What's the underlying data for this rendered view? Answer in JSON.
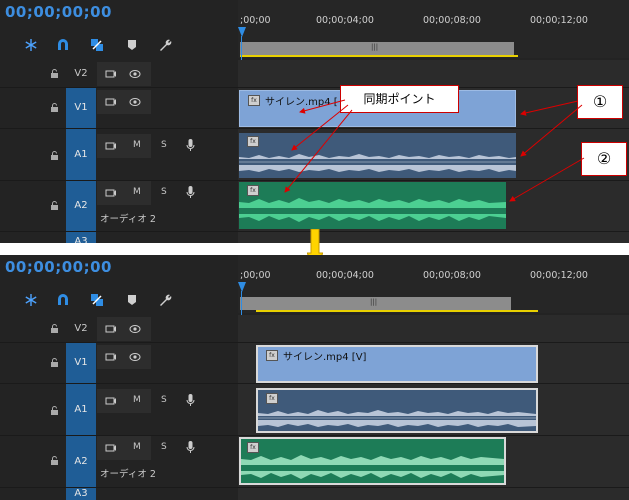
{
  "timecode": "00;00;00;00",
  "ruler_labels": [
    ";00;00",
    "00;00;04;00",
    "00;00;08;00",
    "00;00;12;00"
  ],
  "workbar_label": "|||",
  "tracks": {
    "v2": "V2",
    "v1": "V1",
    "a1": "A1",
    "a2": "A2",
    "a3": "A3",
    "a2_name": "オーディオ 2",
    "mute": "M",
    "solo": "S"
  },
  "clip_video_name": "サイレン.mp4 [",
  "clip_video_name_b": "サイレン.mp4 [V]",
  "fx_label": "fx",
  "callout_label": "同期ポイント",
  "marker1": "①",
  "marker2": "②",
  "colors": {
    "accent": "#2f8de4",
    "video_clip": "#7ea3d6",
    "audio1_clip": "#3f5a7a",
    "audio2_clip": "#1d7c57",
    "callout_border": "#cc0000",
    "arrow_yellow": "#ffd400"
  },
  "icons": [
    "snowflake-icon",
    "magnet-icon",
    "link-icon",
    "marker-icon",
    "wrench-icon",
    "lock-icon",
    "film-icon",
    "eye-icon",
    "mic-icon",
    "fx-icon"
  ]
}
